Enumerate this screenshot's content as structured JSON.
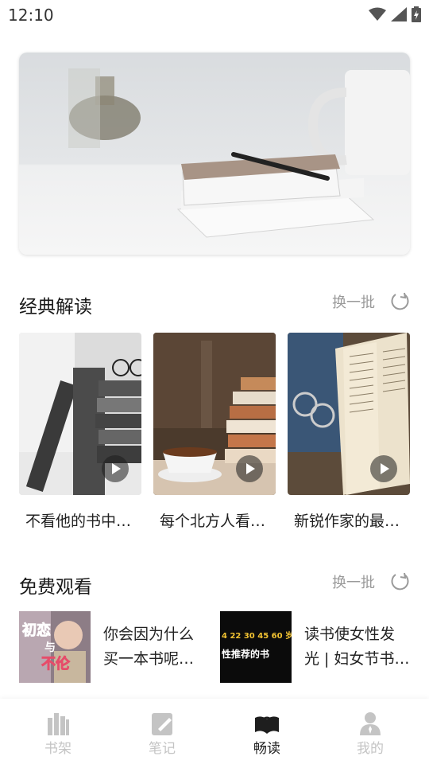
{
  "status_bar": {
    "time": "12:10"
  },
  "sections": {
    "classic": {
      "title": "经典解读",
      "refresh_label": "换一批"
    },
    "free": {
      "title": "免费观看",
      "refresh_label": "换一批"
    }
  },
  "classic_cards": [
    {
      "caption": "不看他的书中…"
    },
    {
      "caption": "每个北方人看…"
    },
    {
      "caption": "新锐作家的最…"
    }
  ],
  "free_items": [
    {
      "line1": "你会因为什么",
      "line2": "买一本书呢…",
      "thumb_text_1": "初恋",
      "thumb_text_2": "与",
      "thumb_text_3": "不伦"
    },
    {
      "line1": "读书使女性发",
      "line2": "光 | 妇女节书…",
      "thumb_text_1": "4 22 30 45 60 岁",
      "thumb_text_2": "性推荐的书"
    }
  ],
  "tabs": [
    {
      "label": "书架",
      "icon": "bookshelf-icon"
    },
    {
      "label": "笔记",
      "icon": "note-icon"
    },
    {
      "label": "畅读",
      "icon": "open-book-icon",
      "active": true
    },
    {
      "label": "我的",
      "icon": "person-icon"
    }
  ],
  "colors": {
    "active_tab": "#222222",
    "inactive_tab": "#c4c4c4",
    "muted_text": "#9a9a9a"
  }
}
